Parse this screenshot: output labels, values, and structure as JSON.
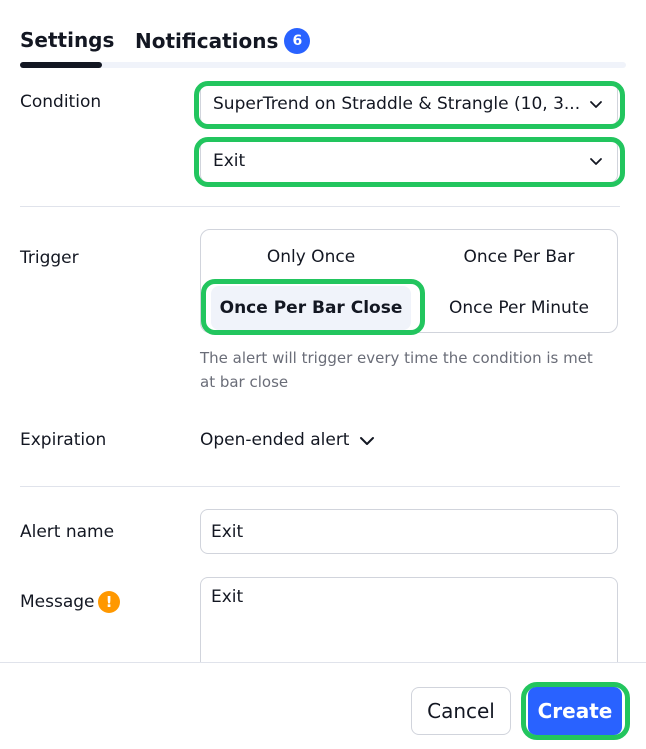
{
  "tabs": {
    "settings": "Settings",
    "notifications": "Notifications",
    "notifications_count": "6"
  },
  "condition": {
    "label": "Condition",
    "indicator": "SuperTrend on Straddle & Strangle (10, 3...",
    "action": "Exit"
  },
  "trigger": {
    "label": "Trigger",
    "options": [
      "Only Once",
      "Once Per Bar",
      "Once Per Bar Close",
      "Once Per Minute"
    ],
    "selected": "Once Per Bar Close",
    "hint": "The alert will trigger every time the condition is met at bar close"
  },
  "expiration": {
    "label": "Expiration",
    "value": "Open-ended alert"
  },
  "alert_name": {
    "label": "Alert name",
    "value": "Exit"
  },
  "message": {
    "label": "Message",
    "value": "Exit",
    "warning_icon": "warning-icon"
  },
  "footer": {
    "cancel": "Cancel",
    "create": "Create"
  },
  "colors": {
    "accent": "#2962ff",
    "highlight": "#22c55e",
    "warning": "#ff9800"
  }
}
